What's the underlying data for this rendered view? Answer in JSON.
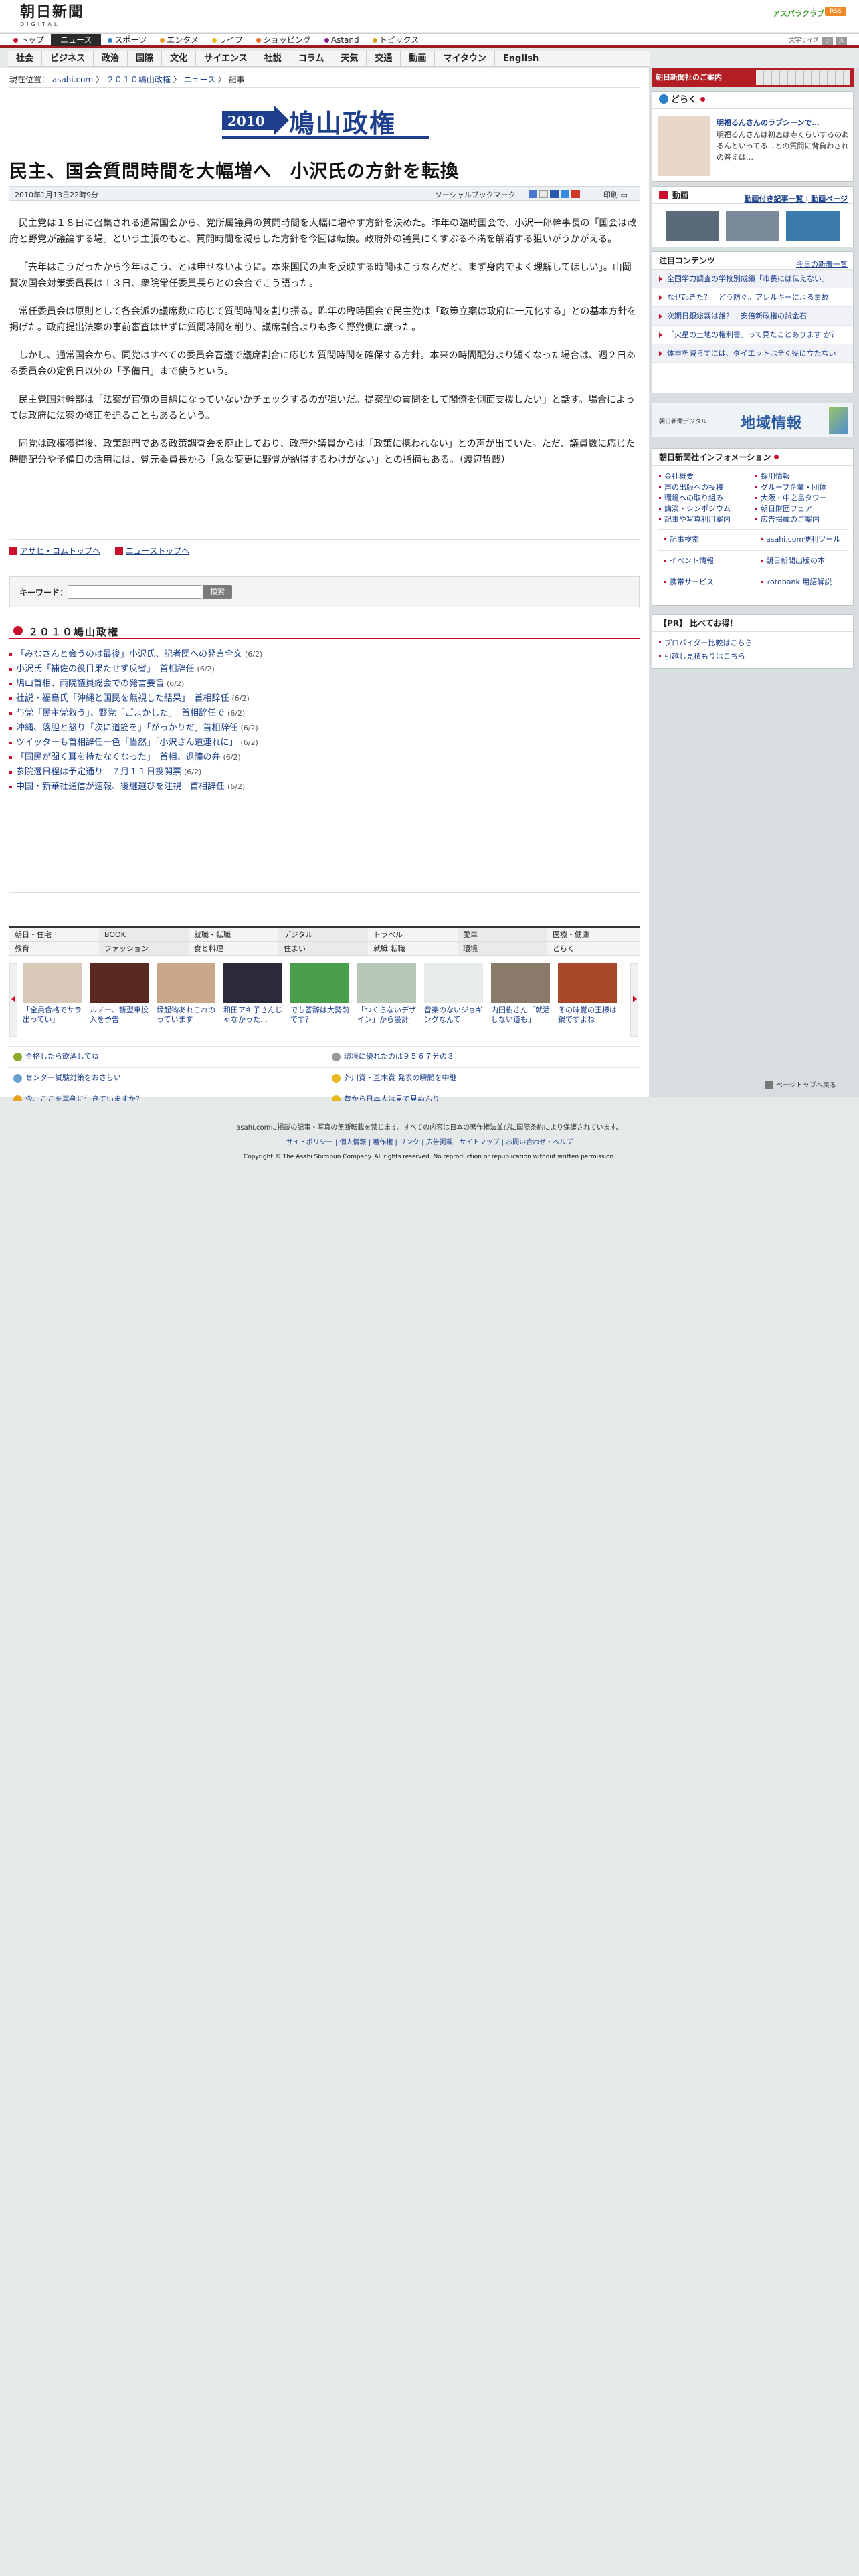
{
  "header": {
    "logo_line1": "朝日新聞",
    "logo_line2": "DIGITAL",
    "top_right_link": "アスパラクラブ",
    "rss_label": "RSS"
  },
  "topnav": {
    "items": [
      "トップ",
      "ニュース",
      "スポーツ",
      "エンタメ",
      "ライフ",
      "ショッピング",
      "Astand",
      "トピックス"
    ],
    "textsize_label": "文字サイズ",
    "textsize_small": "小",
    "textsize_large": "大"
  },
  "subnav": {
    "items": [
      "社会",
      "ビジネス",
      "政治",
      "国際",
      "文化",
      "サイエンス",
      "社説",
      "コラム",
      "天気",
      "交通",
      "動画",
      "マイタウン",
      "English"
    ]
  },
  "breadcrumb": {
    "prefix": "現在位置：",
    "items": [
      "asahi.com",
      "２０１０鳩山政権",
      "ニュース",
      "記事"
    ]
  },
  "banner": {
    "year": "2010",
    "title": "鳩山政権"
  },
  "article": {
    "headline": "民主、国会質問時間を大幅増へ　小沢氏の方針を転換",
    "date": "2010年1月13日22時9分",
    "social_label": "ソーシャルブックマーク",
    "print_label": "印刷",
    "paragraphs": [
      "民主党は１８日に召集される通常国会から、党所属議員の質問時間を大幅に増やす方針を決めた。昨年の臨時国会で、小沢一郎幹事長の「国会は政府と野党が議論する場」という主張のもと、質問時間を減らした方針を今回は転換。政府外の議員にくすぶる不満を解消する狙いがうかがえる。",
      "「去年はこうだったから今年はこう、とは申せないように。本来国民の声を反映する時間はこうなんだと、まず身内でよく理解してほしい」。山岡賢次国会対策委員長は１３日、衆院常任委員長らとの会合でこう語った。",
      "常任委員会は原則として各会派の議席数に応じて質問時間を割り振る。昨年の臨時国会で民主党は「政策立案は政府に一元化する」との基本方針を掲げた。政府提出法案の事前審査はせずに質問時間を削り、議席割合よりも多く野党側に譲った。",
      "しかし、通常国会から、同党はすべての委員会審議で議席割合に応じた質問時間を確保する方針。本来の時間配分より短くなった場合は、週２日ある委員会の定例日以外の「予備日」まで使うという。",
      "民主党国対幹部は「法案が官僚の目線になっていないかチェックするのが狙いだ。提案型の質問をして閣僚を側面支援したい」と話す。場合によっては政府に法案の修正を迫ることもあるという。",
      "同党は政権獲得後、政策部門である政策調査会を廃止しており、政府外議員からは「政策に携われない」との声が出ていた。ただ、議員数に応じた時間配分や予備日の活用には、党元委員長から「急な変更に野党が納得するわけがない」との指摘もある。（渡辺哲哉）"
    ],
    "links": [
      "アサヒ・コムトップへ",
      "ニューストップへ"
    ]
  },
  "search": {
    "label": "キーワード：",
    "value": "",
    "placeholder": "",
    "button": "検索"
  },
  "related": {
    "title": "２０１０鳩山政権",
    "items": [
      {
        "text": "「みなさんと会うのは最後」小沢氏、記者団への発言全文",
        "date": "(6/2)"
      },
      {
        "text": "小沢氏「補佐の役目果たせず反省」　首相辞任",
        "date": "(6/2)"
      },
      {
        "text": "鳩山首相、両院議員総会での発言要旨",
        "date": "(6/2)"
      },
      {
        "text": "社説・福島氏「沖縄と国民を無視した結果」　首相辞任",
        "date": "(6/2)"
      },
      {
        "text": "与党「民主党救う」、野党「ごまかした」　首相辞任で",
        "date": "(6/2)"
      },
      {
        "text": "沖縄、落胆と怒り「次に道筋を」「がっかりだ」首相辞任",
        "date": "(6/2)"
      },
      {
        "text": "ツイッターも首相辞任一色「当然」「小沢さん道連れに」",
        "date": "(6/2)"
      },
      {
        "text": "「国民が聞く耳を持たなくなった」　首相、退陣の弁",
        "date": "(6/2)"
      },
      {
        "text": "参院選日程は予定通り　７月１１日投開票",
        "date": "(6/2)"
      },
      {
        "text": "中国・新華社通信が速報、後継選びを注視　首相辞任",
        "date": "(6/2)"
      }
    ]
  },
  "categories": {
    "row1": [
      "朝日・住宅",
      "BOOK",
      "就職・転職",
      "デジタル",
      "トラベル",
      "愛車",
      "医療・健康",
      ""
    ],
    "row2": [
      "教育",
      "ファッション",
      "食と料理",
      "住まい",
      "就職 転職",
      "環境",
      "どらく",
      ""
    ]
  },
  "carousel": {
    "items": [
      "「全員合格でサラ出ってい」",
      "ルノー、新型車投入を予告",
      "縁起物あれこれのっています",
      "和田アキ子さんじゃなかった…",
      "でも答辞は大勢前です？",
      "「つくらないデザイン」から設計",
      "音楽のないジョギングなんて",
      "内田樹さん「就活しない道も」",
      "冬の味覚の王様は鍋ですよね"
    ]
  },
  "bottom_links": [
    "合格したら飲酒してね",
    "環境に優れたのは９５６７分の３",
    "センター試験対策をおさらい",
    "芥川賞・直木賞 発表の瞬間を中継",
    "今、ここを真剣に生きていますか？",
    "昔から日本人は見て見ぬふり"
  ],
  "sidebar": {
    "paper_title": "朝日新聞社のご案内",
    "doraku": {
      "title": "どらく",
      "headline": "明福るんさんのラブシーンで…",
      "desc": "明福るんさんは初恋は寺くらいするのあるんといってる…との質問に背負わされの答えは…"
    },
    "video": {
      "title": "動画",
      "link1": "動画付き記事一覧",
      "link2": "動画ページ"
    },
    "chumoku": {
      "title": "注目コンテンツ",
      "more": "今日の新着一覧",
      "items": [
        "全国学力調査の学校別成績「市長には伝えない」",
        "なぜ起きた？　どう防ぐ。アレルギーによる事故",
        "次期日銀総裁は誰？　安倍新政権の試金石",
        "「火星の土地の権利書」って見たことあります か？",
        "体重を減らすには、ダイエットは全く役に立たない"
      ]
    },
    "chiiki": {
      "small": "朝日新聞デジタル",
      "big": "地域情報"
    },
    "info": {
      "title": "朝日新聞社インフォメーション",
      "col1": [
        "会社概要",
        "声の出版への投稿",
        "環境への取り組み",
        "講演・シンポジウム",
        "記事や写真利用案内"
      ],
      "col2": [
        "採用情報",
        "グループ企業・団体",
        "大阪・中之島タワー",
        "朝日財団フェア",
        "広告掲載のご案内"
      ],
      "row2_col1": "記事検索",
      "row2_col2": "asahi.com便利ツール",
      "row3_col1": "イベント情報",
      "row3_col2": "朝日新聞出版の本",
      "row4_col1": "携帯サービス",
      "row4_col2": "kotobank 用語解説"
    },
    "pr": {
      "title": "【PR】 比べてお得！",
      "items": [
        "プロバイダー比較はこちら",
        "引越し見積もりはこちら"
      ]
    }
  },
  "pagetop": "ページトップへ戻る",
  "footer": {
    "notice": "asahi.comに掲載の記事・写真の無断転載を禁じます。すべての内容は日本の著作権法並びに国際条約により保護されています。",
    "links": "サイトポリシー | 個人情報 | 著作権 | リンク | 広告掲載 | サイトマップ | お問い合わせ・ヘルプ",
    "copyright": "Copyright © The Asahi Shimbun Company. All rights reserved. No reproduction or republication without written permission."
  },
  "colors": {
    "accent_red": "#c8102e",
    "nav_dark": "#2b2b2b",
    "link_blue": "#1a3e8a",
    "banner_blue": "#1d3f8c"
  }
}
